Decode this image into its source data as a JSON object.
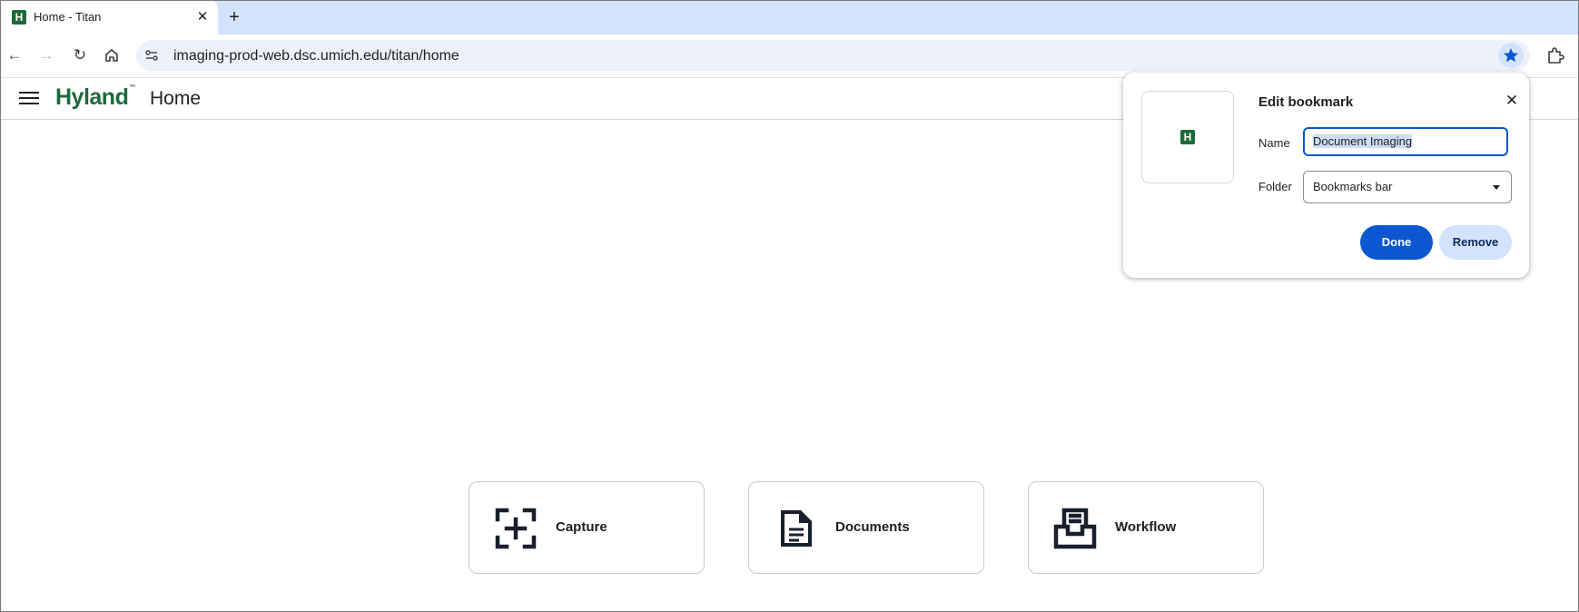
{
  "browser": {
    "tab": {
      "title": "Home - Titan",
      "favicon_letter": "H"
    },
    "new_tab_label": "+",
    "close_tab_label": "✕",
    "nav": {
      "back": "←",
      "forward": "→",
      "reload": "↻",
      "home": "home-icon"
    },
    "url": "imaging-prod-web.dsc.umich.edu/titan/home",
    "bookmark_starred": true
  },
  "app": {
    "brand": "Hyland",
    "brand_mark": "™",
    "page_title": "Home",
    "tiles": [
      {
        "label": "Capture",
        "icon": "capture-icon"
      },
      {
        "label": "Documents",
        "icon": "document-icon"
      },
      {
        "label": "Workflow",
        "icon": "inbox-tray-icon"
      }
    ]
  },
  "bookmark_popup": {
    "title": "Edit bookmark",
    "close_label": "✕",
    "name_label": "Name",
    "name_value": "Document Imaging",
    "folder_label": "Folder",
    "folder_value": "Bookmarks bar",
    "done_label": "Done",
    "remove_label": "Remove",
    "favicon_letter": "H"
  },
  "colors": {
    "brand_green": "#1d6a3b",
    "chrome_blue": "#0b57d0",
    "tabstrip": "#d3e3fd"
  }
}
